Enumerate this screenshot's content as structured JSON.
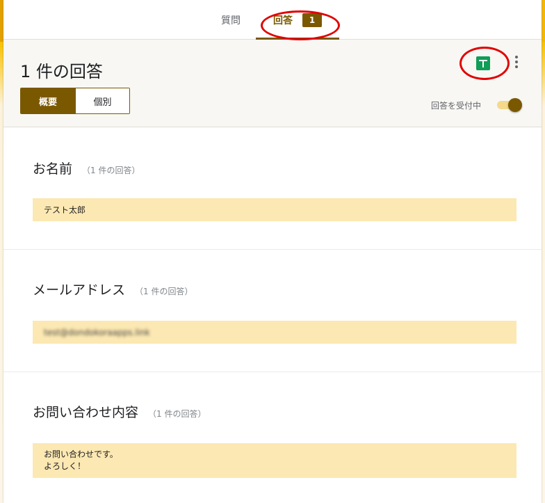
{
  "tabs": {
    "questions_label": "質問",
    "responses_label": "回答",
    "responses_badge": "1"
  },
  "header": {
    "title": "1 件の回答",
    "summary_label": "概要",
    "individual_label": "個別",
    "accepting_label": "回答を受付中"
  },
  "questions": [
    {
      "title": "お名前",
      "count": "（1 件の回答）",
      "answer": "テスト太郎"
    },
    {
      "title": "メールアドレス",
      "count": "（1 件の回答）",
      "answer": "test@dondokoraapps.link"
    },
    {
      "title": "お問い合わせ内容",
      "count": "（1 件の回答）",
      "answer": "お問い合わせです。\nよろしく！"
    }
  ],
  "colors": {
    "accent": "#7a5800",
    "answer_bg": "#fce8b2",
    "sheets_green": "#0f9d58",
    "annotation_red": "#e10000"
  },
  "icons": [
    "sheets-icon",
    "more-vert-icon"
  ]
}
